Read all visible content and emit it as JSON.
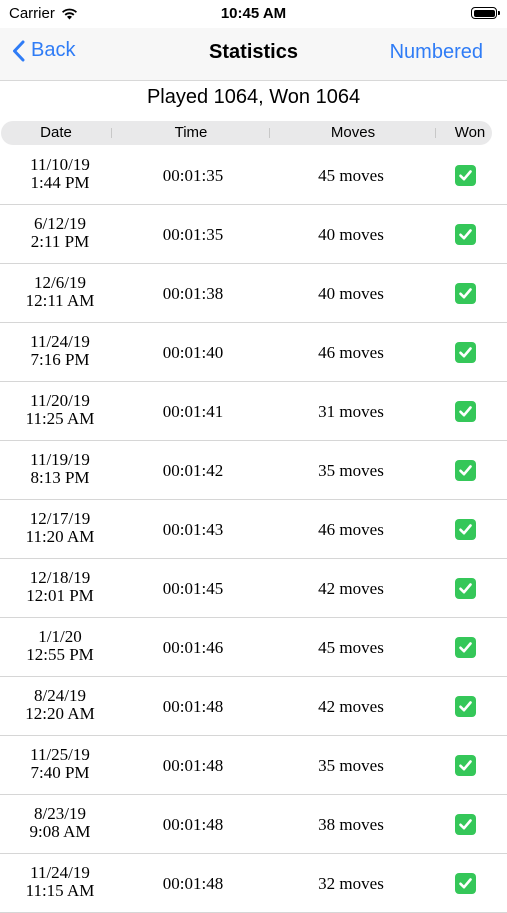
{
  "status_bar": {
    "carrier": "Carrier",
    "time": "10:45 AM"
  },
  "nav": {
    "back_label": "Back",
    "title": "Statistics",
    "right_label": "Numbered"
  },
  "summary": "Played 1064, Won 1064",
  "columns": {
    "date": "Date",
    "time": "Time",
    "moves": "Moves",
    "won": "Won"
  },
  "games": [
    {
      "date": "11/10/19",
      "clock": "1:44 PM",
      "time": "00:01:35",
      "moves": "45 moves",
      "won": true
    },
    {
      "date": "6/12/19",
      "clock": "2:11 PM",
      "time": "00:01:35",
      "moves": "40 moves",
      "won": true
    },
    {
      "date": "12/6/19",
      "clock": "12:11 AM",
      "time": "00:01:38",
      "moves": "40 moves",
      "won": true
    },
    {
      "date": "11/24/19",
      "clock": "7:16 PM",
      "time": "00:01:40",
      "moves": "46 moves",
      "won": true
    },
    {
      "date": "11/20/19",
      "clock": "11:25 AM",
      "time": "00:01:41",
      "moves": "31 moves",
      "won": true
    },
    {
      "date": "11/19/19",
      "clock": "8:13 PM",
      "time": "00:01:42",
      "moves": "35 moves",
      "won": true
    },
    {
      "date": "12/17/19",
      "clock": "11:20 AM",
      "time": "00:01:43",
      "moves": "46 moves",
      "won": true
    },
    {
      "date": "12/18/19",
      "clock": "12:01 PM",
      "time": "00:01:45",
      "moves": "42 moves",
      "won": true
    },
    {
      "date": "1/1/20",
      "clock": "12:55 PM",
      "time": "00:01:46",
      "moves": "45 moves",
      "won": true
    },
    {
      "date": "8/24/19",
      "clock": "12:20 AM",
      "time": "00:01:48",
      "moves": "42 moves",
      "won": true
    },
    {
      "date": "11/25/19",
      "clock": "7:40 PM",
      "time": "00:01:48",
      "moves": "35 moves",
      "won": true
    },
    {
      "date": "8/23/19",
      "clock": "9:08 AM",
      "time": "00:01:48",
      "moves": "38 moves",
      "won": true
    },
    {
      "date": "11/24/19",
      "clock": "11:15 AM",
      "time": "00:01:48",
      "moves": "32 moves",
      "won": true
    }
  ],
  "icons": {
    "won": "check-icon",
    "back": "chevron-left-icon",
    "signal": "wifi-icon",
    "battery": "battery-icon"
  },
  "colors": {
    "accent": "#2f7cf6",
    "won": "#35c759"
  }
}
